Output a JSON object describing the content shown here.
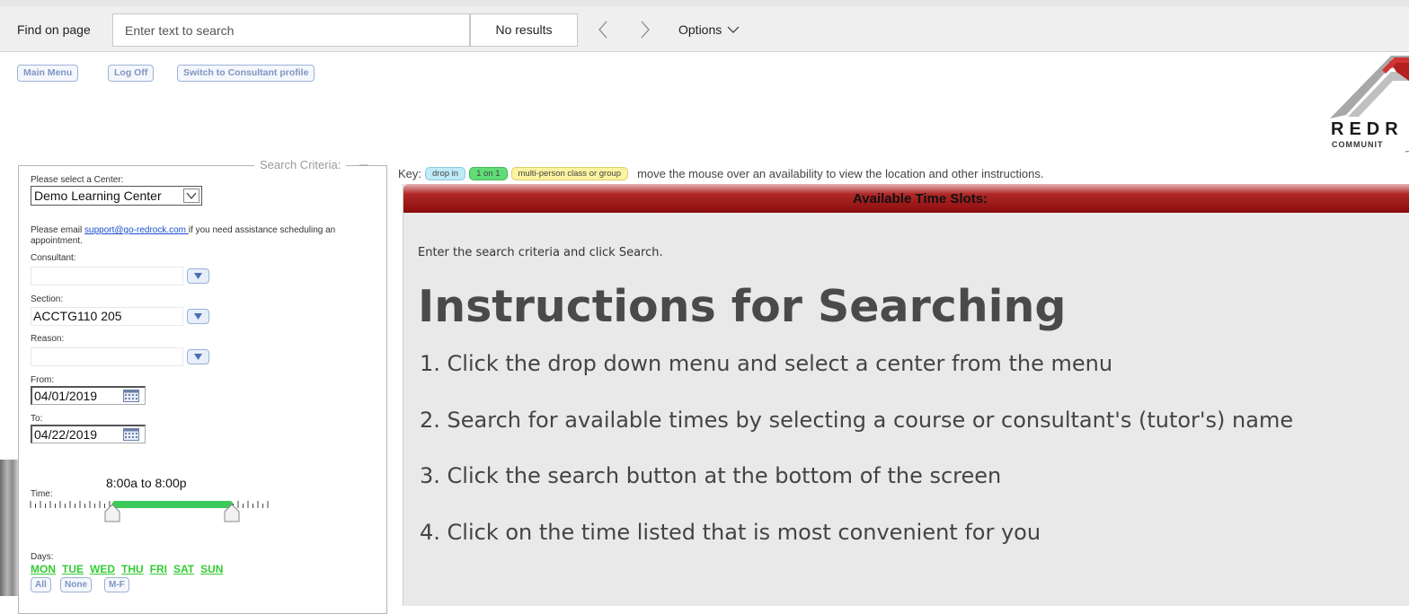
{
  "findbar": {
    "label": "Find on page",
    "placeholder": "Enter text to search",
    "results": "No results",
    "options_label": "Options"
  },
  "top_buttons": {
    "main_menu": "Main Menu",
    "log_off": "Log Off",
    "switch_profile": "Switch to Consultant profile"
  },
  "logo": {
    "line1": "REDR",
    "line2": "COMMUNIT",
    "line3": "R"
  },
  "criteria": {
    "legend": "Search Criteria:",
    "center_label": "Please select a Center:",
    "center_value": "Demo Learning Center",
    "info_before": "Please email ",
    "info_link": "support@go-redrock.com ",
    "info_after": "if you need assistance scheduling an appointment.",
    "consultant_label": "Consultant:",
    "consultant_value": "",
    "section_label": "Section:",
    "section_value": "ACCTG110 205",
    "reason_label": "Reason:",
    "reason_value": "",
    "from_label": "From:",
    "from_value": "04/01/2019",
    "to_label": "To:",
    "to_value": "04/22/2019",
    "time_label": "Time:",
    "time_range": "8:00a to 8:00p",
    "days_label": "Days:",
    "days": [
      "MON",
      "TUE",
      "WED",
      "THU",
      "FRI",
      "SAT",
      "SUN"
    ],
    "day_buttons": {
      "all": "All",
      "none": "None",
      "mf": "M-F"
    }
  },
  "key": {
    "label": "Key:",
    "drop_in": "drop in",
    "one_on_one": "1 on 1",
    "group": "multi-person class or group",
    "hint": "move the mouse over an availability to view the location and other instructions."
  },
  "slots": {
    "header": "Available Time Slots:",
    "enter_msg": "Enter the search criteria and click Search.",
    "title": "Instructions for Searching",
    "steps": [
      "1. Click the drop down menu and select a center from the menu",
      "2. Search for available times by selecting a course or consultant's (tutor's) name",
      "3. Click the search button at the bottom of the screen",
      "4. Click on the time listed that is most convenient for you"
    ]
  },
  "colors": {
    "header_red": "#8a0c0c",
    "days_green": "#33cc33",
    "slider_green": "#3cc85a",
    "link_blue": "#1a4fd0"
  }
}
